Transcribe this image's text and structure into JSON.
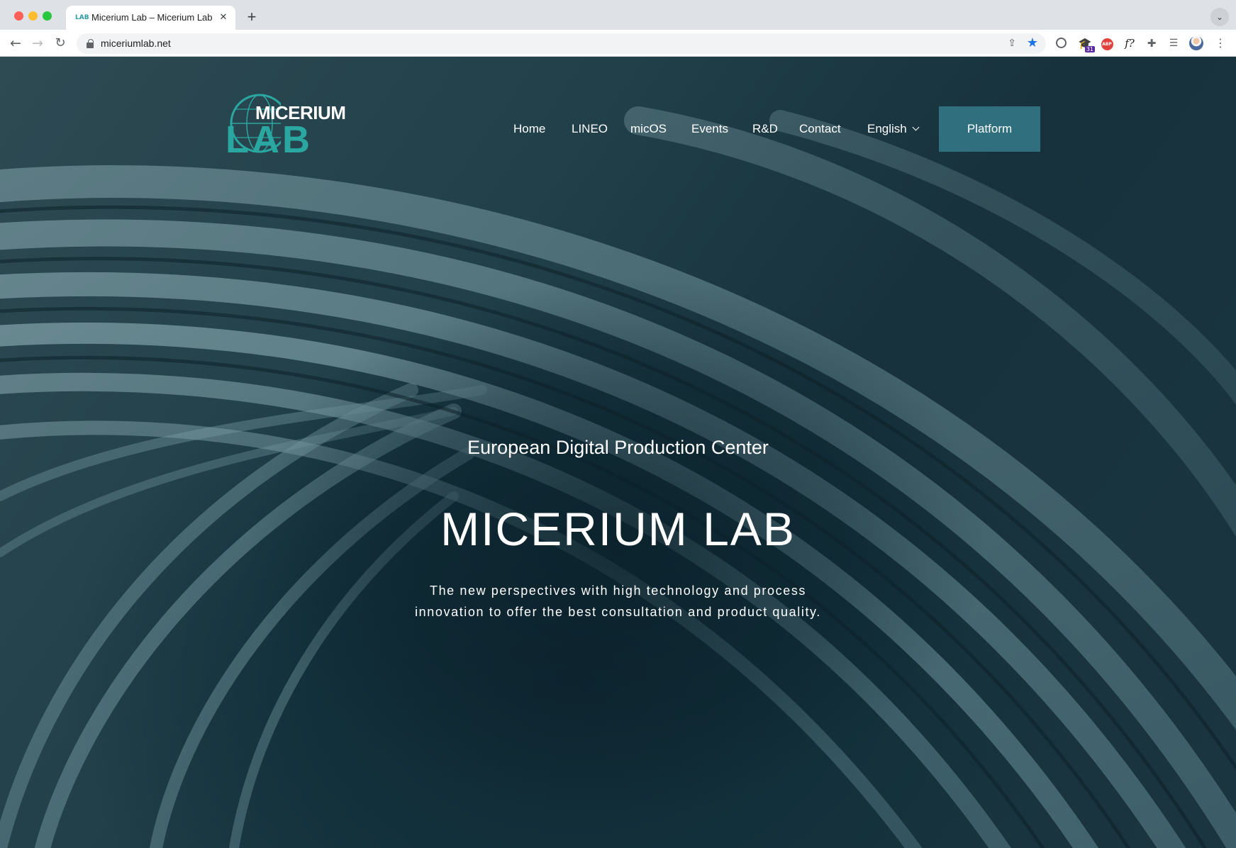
{
  "browser": {
    "tab_title": "Micerium Lab – Micerium Lab",
    "tab_favicon": "LAB",
    "url": "miceriumlab.net",
    "extension_badge": "31",
    "extension_abp": "ABP",
    "extension_f": "f?"
  },
  "site": {
    "logo_text_top": "MICERIUM",
    "logo_text_bottom": "LAB",
    "nav": {
      "home": "Home",
      "lineo": "LINEO",
      "micos": "micOS",
      "events": "Events",
      "rd": "R&D",
      "contact": "Contact",
      "language": "English",
      "platform": "Platform"
    },
    "hero": {
      "subtitle": "European Digital Production Center",
      "title": "MICERIUM LAB",
      "description_line1": "The new perspectives with high technology and process",
      "description_line2": "innovation to offer the best consultation and product quality."
    }
  },
  "colors": {
    "accent": "#2f6f7e",
    "logo_teal": "#2aa7a1",
    "background": "#17323c"
  }
}
